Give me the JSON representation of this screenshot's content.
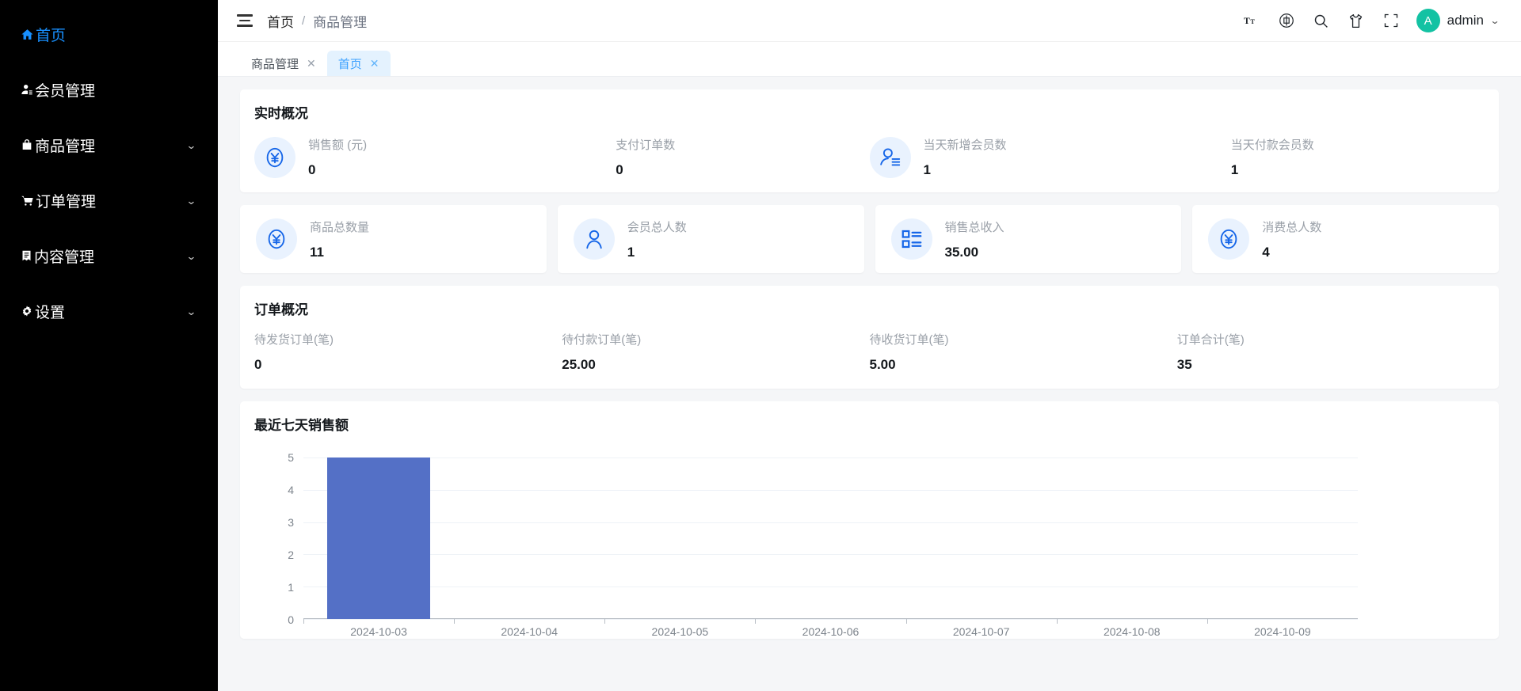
{
  "sidebar": {
    "items": [
      {
        "label": "首页",
        "icon": "home-icon",
        "glyph": "⌂",
        "active": true,
        "expandable": false
      },
      {
        "label": "会员管理",
        "icon": "user-icon",
        "glyph": "👤",
        "active": false,
        "expandable": false
      },
      {
        "label": "商品管理",
        "icon": "shopping-bag-icon",
        "glyph": "💼",
        "active": false,
        "expandable": true
      },
      {
        "label": "订单管理",
        "icon": "shopping-cart-icon",
        "glyph": "🛒",
        "active": false,
        "expandable": true
      },
      {
        "label": "内容管理",
        "icon": "document-icon",
        "glyph": "📑",
        "active": false,
        "expandable": true
      },
      {
        "label": "设置",
        "icon": "gear-icon",
        "glyph": "⚙",
        "active": false,
        "expandable": true
      }
    ]
  },
  "topbar": {
    "breadcrumb": {
      "root": "首页",
      "separator": "/",
      "current": "商品管理"
    },
    "icons": [
      {
        "name": "font-size-icon",
        "label": "Tᴛ"
      },
      {
        "name": "language-icon",
        "label": "中"
      },
      {
        "name": "search-icon",
        "label": "search"
      },
      {
        "name": "theme-shirt-icon",
        "label": "shirt"
      },
      {
        "name": "fullscreen-icon",
        "label": "fullscreen"
      }
    ],
    "user": {
      "initial": "A",
      "name": "admin"
    }
  },
  "tabs": [
    {
      "label": "商品管理",
      "close": "✕",
      "active": false
    },
    {
      "label": "首页",
      "close": "✕",
      "active": true
    }
  ],
  "realtime": {
    "title": "实时概况",
    "stats": [
      {
        "label": "销售额 (元)",
        "value": "0",
        "icon": "yen-circle-icon",
        "has_icon": true
      },
      {
        "label": "支付订单数",
        "value": "0",
        "icon": "none",
        "has_icon": false
      },
      {
        "label": "当天新增会员数",
        "value": "1",
        "icon": "add-user-icon",
        "has_icon": true
      },
      {
        "label": "当天付款会员数",
        "value": "1",
        "icon": "none",
        "has_icon": false
      }
    ]
  },
  "kpis": [
    {
      "label": "商品总数量",
      "value": "11",
      "icon": "yen-circle-icon"
    },
    {
      "label": "会员总人数",
      "value": "1",
      "icon": "person-icon"
    },
    {
      "label": "销售总收入",
      "value": "35.00",
      "icon": "list-icon"
    },
    {
      "label": "消费总人数",
      "value": "4",
      "icon": "yen-circle-icon"
    }
  ],
  "orders": {
    "title": "订单概况",
    "cells": [
      {
        "label": "待发货订单(笔)",
        "value": "0"
      },
      {
        "label": "待付款订单(笔)",
        "value": "25.00"
      },
      {
        "label": "待收货订单(笔)",
        "value": "5.00"
      },
      {
        "label": "订单合计(笔)",
        "value": "35"
      }
    ]
  },
  "chart_data": {
    "type": "bar",
    "title": "最近七天销售额",
    "categories": [
      "2024-10-03",
      "2024-10-04",
      "2024-10-05",
      "2024-10-06",
      "2024-10-07",
      "2024-10-08",
      "2024-10-09"
    ],
    "values": [
      5,
      0,
      0,
      0,
      0,
      0,
      0
    ],
    "yticks": [
      "5",
      "4",
      "3",
      "2",
      "1",
      "0"
    ],
    "ylim": [
      0,
      5
    ],
    "xlabel": "",
    "ylabel": "",
    "grid": true,
    "legend": false,
    "series_color": "#5470c6"
  },
  "colors": {
    "sidebar_bg": "#000000",
    "accent": "#1890ff",
    "avatar": "#13c2a3",
    "bar": "#5470c6",
    "icon_blue": "#1666e8",
    "icon_bg": "#e9f2fe"
  }
}
